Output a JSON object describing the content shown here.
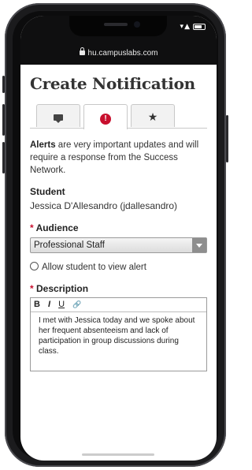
{
  "browser": {
    "url": "hu.campuslabs.com"
  },
  "page": {
    "title": "Create Notification"
  },
  "tabs": [
    {
      "name": "notes",
      "icon": "speech-bubble-icon"
    },
    {
      "name": "alerts",
      "icon": "alert-icon",
      "glyph": "!",
      "active": true
    },
    {
      "name": "favorites",
      "icon": "star-icon",
      "glyph": "★"
    }
  ],
  "intro": {
    "bold": "Alerts",
    "rest": " are very important updates and will require a response from the Success Network."
  },
  "student": {
    "label": "Student",
    "value": "Jessica D'Allesandro (jdallesandro)"
  },
  "audience": {
    "required_mark": "*",
    "label": "Audience",
    "selected": "Professional Staff"
  },
  "allow_view": {
    "label": "Allow student to view alert",
    "checked": false
  },
  "description": {
    "required_mark": "*",
    "label": "Description",
    "toolbar": {
      "bold": "B",
      "italic": "I",
      "underline": "U",
      "link": "🔗"
    },
    "text": "I met with Jessica today and we spoke about her frequent absenteeism and lack of participation in group discussions during class."
  },
  "colors": {
    "accent": "#c8102e",
    "text": "#333333"
  }
}
